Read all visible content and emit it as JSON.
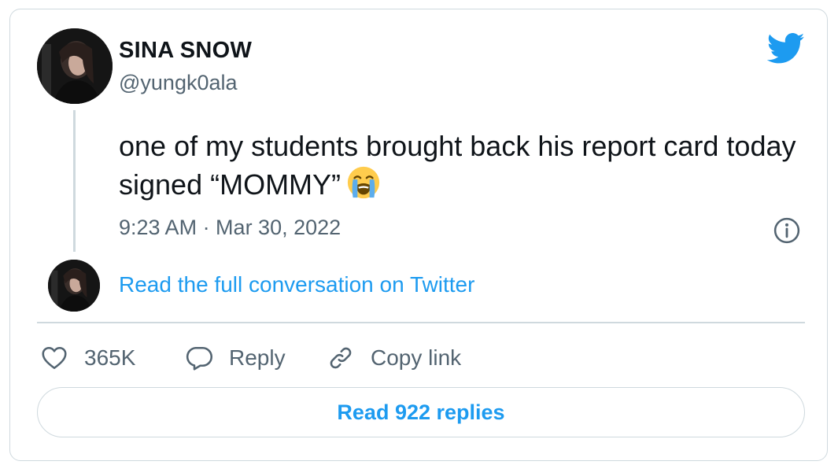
{
  "author": {
    "display_name": "SINA SNOW",
    "handle": "@yungk0ala",
    "avatar_icon": "profile-photo"
  },
  "tweet": {
    "text": "one of my students brought back his report card today signed “MOMMY”",
    "emoji": "loudly-crying-face",
    "timestamp": "9:23 AM · Mar 30, 2022"
  },
  "conversation": {
    "link_label": "Read the full conversation on Twitter"
  },
  "actions": {
    "like_count": "365K",
    "reply_label": "Reply",
    "copy_label": "Copy link"
  },
  "replies": {
    "button_label": "Read 922 replies"
  },
  "colors": {
    "accent": "#1d9bf0",
    "text_primary": "#0f1419",
    "text_secondary": "#536471",
    "border": "#cfd9de"
  }
}
